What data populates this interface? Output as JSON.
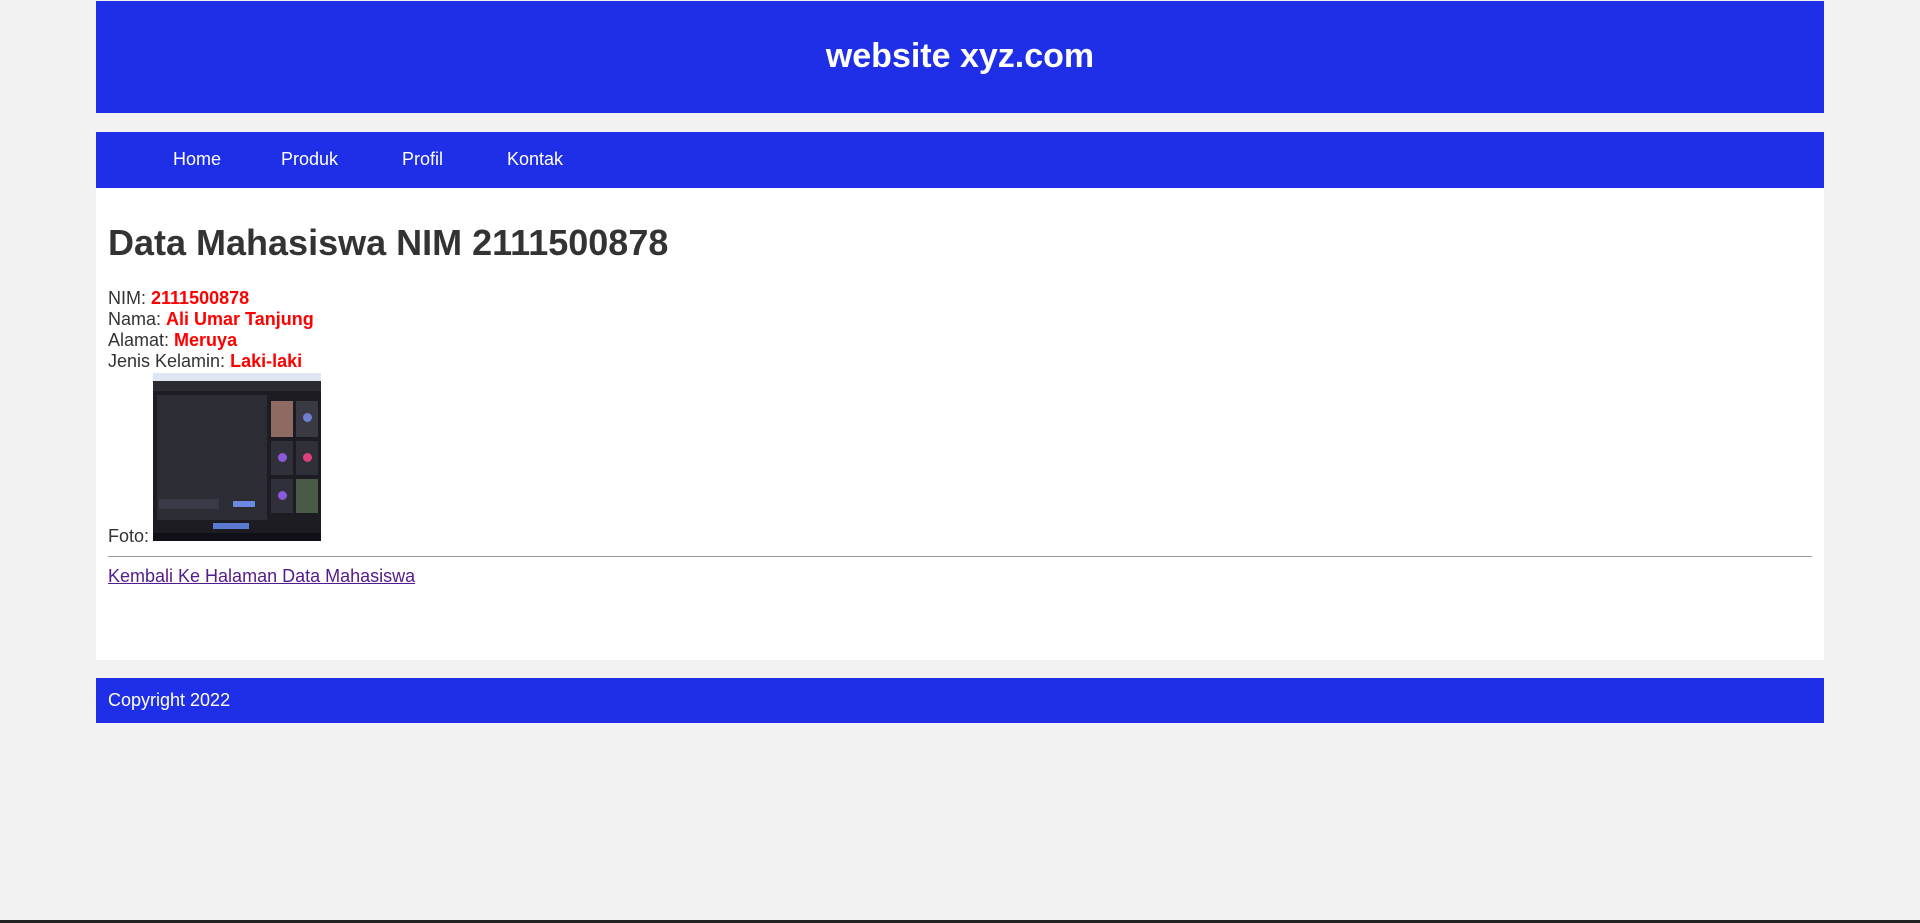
{
  "header": {
    "title": "website xyz.com"
  },
  "nav": {
    "items": [
      {
        "label": "Home"
      },
      {
        "label": "Produk"
      },
      {
        "label": "Profil"
      },
      {
        "label": "Kontak"
      }
    ]
  },
  "main": {
    "heading": "Data Mahasiswa NIM 2111500878",
    "fields": {
      "nim_label": "NIM:",
      "nim_value": "2111500878",
      "nama_label": "Nama:",
      "nama_value": "Ali Umar Tanjung",
      "alamat_label": "Alamat:",
      "alamat_value": "Meruya",
      "jk_label": "Jenis Kelamin:",
      "jk_value": "Laki-laki",
      "foto_label": "Foto:"
    },
    "back_link": "Kembali Ke Halaman Data Mahasiswa"
  },
  "footer": {
    "text": "Copyright 2022"
  },
  "colors": {
    "brand_blue": "#1f2fe8",
    "value_red": "#ff0000",
    "visited_link": "#551a8b",
    "page_bg": "#f2f2f2"
  }
}
